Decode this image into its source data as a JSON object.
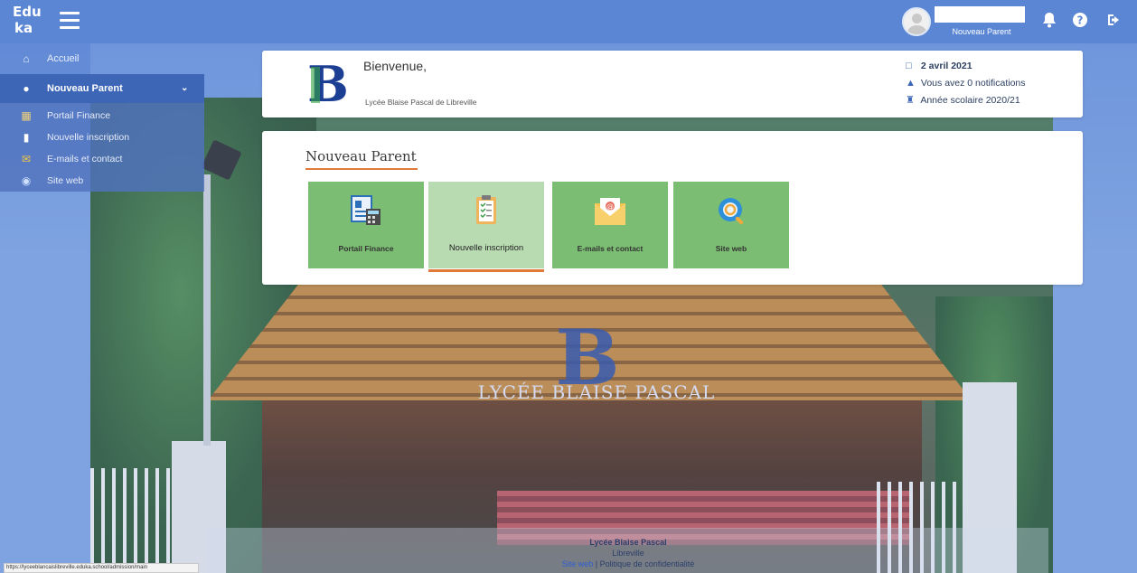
{
  "brand": {
    "line1": "Edu",
    "line2": "ka"
  },
  "user": {
    "role": "Nouveau Parent"
  },
  "sidebar": {
    "home_label": "Accueil",
    "section_label": "Nouveau Parent",
    "items": [
      {
        "label": "Portail Finance",
        "icon": "finance-icon"
      },
      {
        "label": "Nouvelle inscription",
        "icon": "document-icon"
      },
      {
        "label": "E-mails et contact",
        "icon": "mail-icon"
      },
      {
        "label": "Site web",
        "icon": "globe-icon"
      }
    ]
  },
  "welcome": {
    "title": "Bienvenue,",
    "school": "Lycée Blaise Pascal de Libreville",
    "date": "2 avril 2021",
    "notifications": "Vous avez 0 notifications",
    "school_year": "Année scolaire 2020/21"
  },
  "panel": {
    "title": "Nouveau Parent",
    "tiles": [
      {
        "label": "Portail Finance",
        "icon": "finance-portal-icon",
        "active": false
      },
      {
        "label": "Nouvelle inscription",
        "icon": "clipboard-checklist-icon",
        "active": true
      },
      {
        "label": "E-mails et contact",
        "icon": "envelope-icon",
        "active": false
      },
      {
        "label": "Site web",
        "icon": "web-search-icon",
        "active": false
      }
    ]
  },
  "background": {
    "sign_text": "LYCÉE BLAISE PASCAL"
  },
  "footer": {
    "school": "Lycée Blaise Pascal",
    "city": "Libreville",
    "site_link": "Site web",
    "separator": "|",
    "privacy": "Politique de confidentialité"
  },
  "status_url": "https://lyceeblancaislibreville.eduka.school/admission/main",
  "colors": {
    "topbar": "#5b86d4",
    "sidebar_active": "#3d66b7",
    "tile": "#7bbd72",
    "accent": "#e07a3a"
  }
}
